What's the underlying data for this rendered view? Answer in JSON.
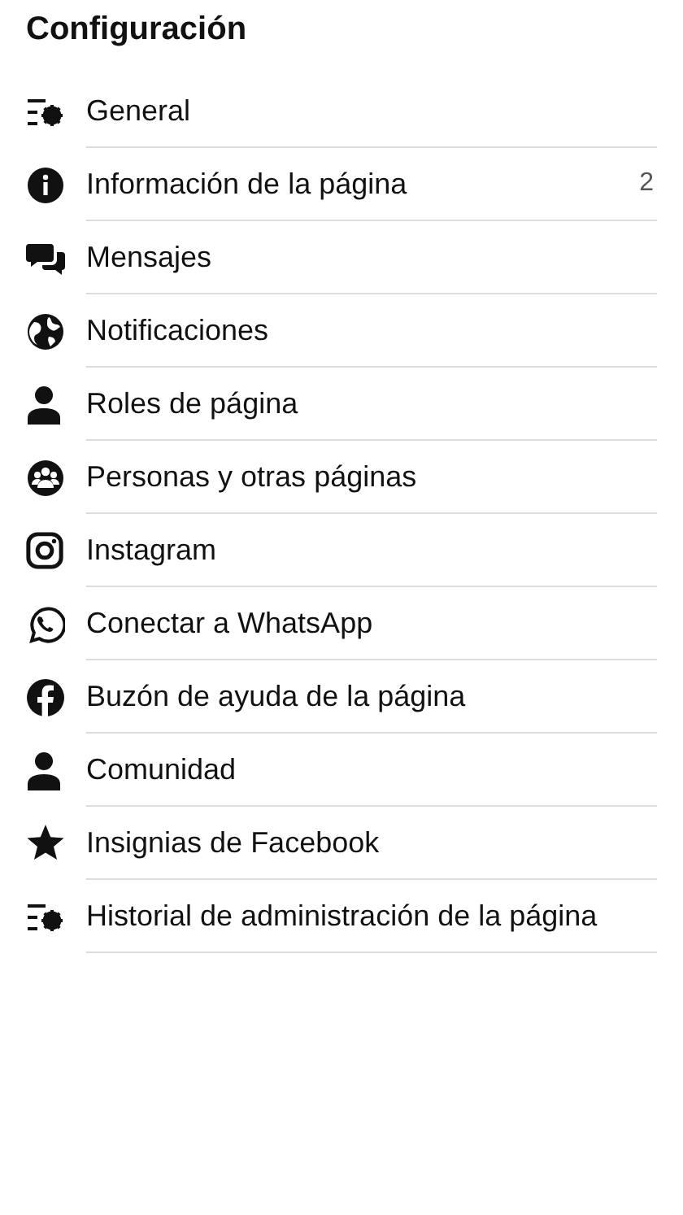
{
  "title": "Configuración",
  "items": [
    {
      "kind": "settings",
      "label": "General"
    },
    {
      "kind": "info",
      "label": "Información de la página",
      "count": "2"
    },
    {
      "kind": "chat",
      "label": "Mensajes"
    },
    {
      "kind": "globe",
      "label": "Notificaciones"
    },
    {
      "kind": "person",
      "label": "Roles de página"
    },
    {
      "kind": "group",
      "label": "Personas y otras páginas"
    },
    {
      "kind": "instagram",
      "label": "Instagram"
    },
    {
      "kind": "whatsapp",
      "label": "Conectar a WhatsApp"
    },
    {
      "kind": "facebook",
      "label": "Buzón de ayuda de la página"
    },
    {
      "kind": "person",
      "label": "Comunidad"
    },
    {
      "kind": "star",
      "label": "Insignias de Facebook"
    },
    {
      "kind": "settings",
      "label": "Historial de administración de la página"
    }
  ]
}
